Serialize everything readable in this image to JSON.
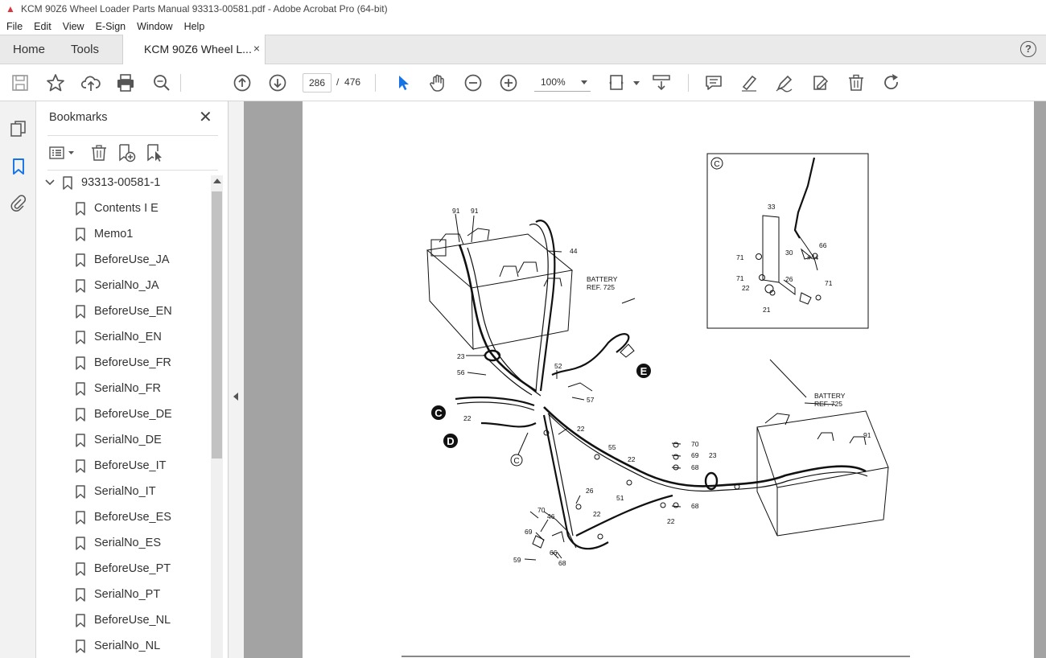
{
  "window": {
    "title": "KCM 90Z6 Wheel Loader Parts Manual 93313-00581.pdf - Adobe Acrobat Pro (64-bit)"
  },
  "menu": [
    "File",
    "Edit",
    "View",
    "E-Sign",
    "Window",
    "Help"
  ],
  "tabs": {
    "home": "Home",
    "tools": "Tools",
    "document": "KCM 90Z6 Wheel L...",
    "close": "×"
  },
  "toolbar": {
    "page_current": "286",
    "page_separator": "/",
    "page_total": "476",
    "zoom": "100%"
  },
  "bookmarks_panel": {
    "title": "Bookmarks",
    "root": "93313-00581-1",
    "items": [
      "Contents I E",
      "Memo1",
      "BeforeUse_JA",
      "SerialNo_JA",
      "BeforeUse_EN",
      "SerialNo_EN",
      "BeforeUse_FR",
      "SerialNo_FR",
      "BeforeUse_DE",
      "SerialNo_DE",
      "BeforeUse_IT",
      "SerialNo_IT",
      "BeforeUse_ES",
      "SerialNo_ES",
      "BeforeUse_PT",
      "SerialNo_PT",
      "BeforeUse_NL",
      "SerialNo_NL"
    ]
  },
  "drawing": {
    "inset_mark": "C",
    "callouts_main": [
      "91",
      "91",
      "44",
      "23",
      "56",
      "22",
      "52",
      "57",
      "22",
      "55",
      "22",
      "51",
      "22",
      "26",
      "70",
      "46",
      "69",
      "66",
      "59",
      "68",
      "22",
      "70",
      "69",
      "68",
      "68",
      "23",
      "91"
    ],
    "callouts_inset": [
      "33",
      "66",
      "71",
      "30",
      "#44",
      "71",
      "26",
      "22",
      "71",
      "21"
    ],
    "battery_label_1": "BATTERY",
    "battery_ref_1": "REF. 725",
    "battery_label_2": "BATTERY",
    "battery_ref_2": "REF. 725",
    "letters": [
      "E",
      "C",
      "D",
      "C"
    ]
  }
}
